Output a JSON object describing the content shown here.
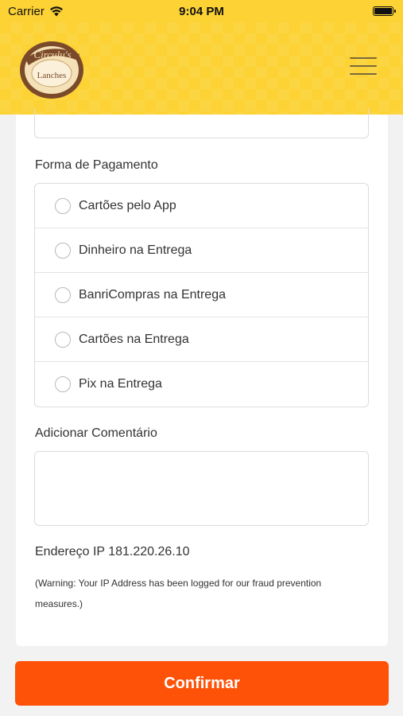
{
  "status_bar": {
    "carrier": "Carrier",
    "time": "9:04 PM"
  },
  "header": {
    "logo_top_text": "Circulu's",
    "logo_bottom_text": "Lanches",
    "menu_icon": "hamburger-menu-icon"
  },
  "payment": {
    "label": "Forma de Pagamento",
    "options": [
      {
        "label": "Cartões pelo App",
        "selected": false
      },
      {
        "label": "Dinheiro na Entrega",
        "selected": false
      },
      {
        "label": "BanriCompras na Entrega",
        "selected": false
      },
      {
        "label": "Cartões na Entrega",
        "selected": false
      },
      {
        "label": "Pix na Entrega",
        "selected": false
      }
    ]
  },
  "comment": {
    "label": "Adicionar Comentário",
    "value": "",
    "placeholder": ""
  },
  "ip": {
    "text": "Endereço IP 181.220.26.10",
    "warning": "(Warning: Your IP Address has been logged for our fraud prevention measures.)"
  },
  "confirm_label": "Confirmar",
  "colors": {
    "header_yellow": "#fcd234",
    "confirm_orange": "#ff5209",
    "logo_brown": "#7b4a2a"
  }
}
